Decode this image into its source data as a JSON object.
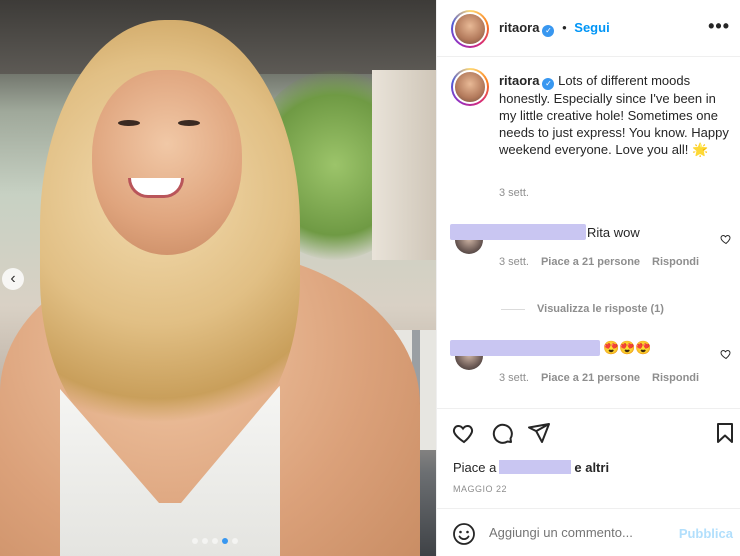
{
  "post": {
    "username": "ritaora",
    "follow_label": "Segui",
    "more_label": "•••"
  },
  "caption": {
    "username": "ritaora",
    "text": "Lots of different moods honestly. Especially since I've been in my little creative hole! Sometimes one needs to just express! You know. Happy weekend everyone. Love you all! 🌟",
    "time": "3 sett."
  },
  "comments": [
    {
      "text": "Rita wow",
      "time": "3 sett.",
      "likes": "Piace a 21 persone",
      "reply": "Rispondi"
    },
    {
      "text": "😍😍😍",
      "time": "3 sett.",
      "likes": "Piace a 21 persone",
      "reply": "Rispondi"
    }
  ],
  "view_replies": "Visualizza le risposte (1)",
  "likes": {
    "prefix": "Piace a",
    "suffix": "e altri"
  },
  "date": "MAGGIO 22",
  "comment_box": {
    "placeholder": "Aggiungi un commento...",
    "publish": "Pubblica"
  },
  "carousel": {
    "prev": "‹",
    "slides": 5,
    "active": 4
  },
  "colors": {
    "accent": "#0095f6",
    "verified": "#3897f0",
    "muted": "#8e8e8e"
  }
}
